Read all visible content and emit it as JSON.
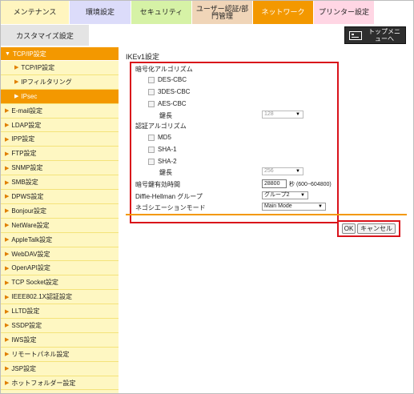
{
  "tabs": [
    {
      "label": "メンテナンス",
      "color": "#fff5bf"
    },
    {
      "label": "環境設定",
      "color": "#dcdcfa"
    },
    {
      "label": "セキュリティ",
      "color": "#d6f2a6"
    },
    {
      "label": "ユーザー認証/部門管理",
      "color": "#f0d5b8"
    },
    {
      "label": "ネットワーク",
      "color": "#f39800"
    },
    {
      "label": "プリンター設定",
      "color": "#ffd6e4"
    }
  ],
  "subtab": {
    "label": "カスタマイズ設定"
  },
  "top_menu": {
    "label": "トップメニューへ"
  },
  "sidebar": {
    "head": "TCP/IP設定",
    "subitems": [
      {
        "label": "TCP/IP設定"
      },
      {
        "label": "IPフィルタリング"
      },
      {
        "label": "IPsec"
      }
    ],
    "items": [
      {
        "label": "E-mail設定"
      },
      {
        "label": "LDAP設定"
      },
      {
        "label": "IPP設定"
      },
      {
        "label": "FTP設定"
      },
      {
        "label": "SNMP設定"
      },
      {
        "label": "SMB設定"
      },
      {
        "label": "DPWS設定"
      },
      {
        "label": "Bonjour設定"
      },
      {
        "label": "NetWare設定"
      },
      {
        "label": "AppleTalk設定"
      },
      {
        "label": "WebDAV設定"
      },
      {
        "label": "OpenAPI設定"
      },
      {
        "label": "TCP Socket設定"
      },
      {
        "label": "IEEE802.1X認証設定"
      },
      {
        "label": "LLTD設定"
      },
      {
        "label": "SSDP設定"
      },
      {
        "label": "IWS設定"
      },
      {
        "label": "リモートパネル設定"
      },
      {
        "label": "JSP設定"
      },
      {
        "label": "ホットフォルダー設定"
      }
    ]
  },
  "main": {
    "title": "IKEv1設定",
    "enc_label": "暗号化アルゴリズム",
    "enc_options": [
      "DES-CBC",
      "3DES-CBC",
      "AES-CBC"
    ],
    "enc_keylen_label": "鍵長",
    "enc_keylen_value": "128",
    "auth_label": "認証アルゴリズム",
    "auth_options": [
      "MD5",
      "SHA-1",
      "SHA-2"
    ],
    "auth_keylen_label": "鍵長",
    "auth_keylen_value": "256",
    "lifetime_label": "暗号鍵有効時間",
    "lifetime_value": "28800",
    "lifetime_unit": "秒 (600~604800)",
    "dh_label": "Diffie-Hellman グループ",
    "dh_value": "グループ2",
    "nego_label": "ネゴシエーションモード",
    "nego_value": "Main Mode"
  },
  "buttons": {
    "ok": "OK",
    "cancel": "キャンセル"
  }
}
